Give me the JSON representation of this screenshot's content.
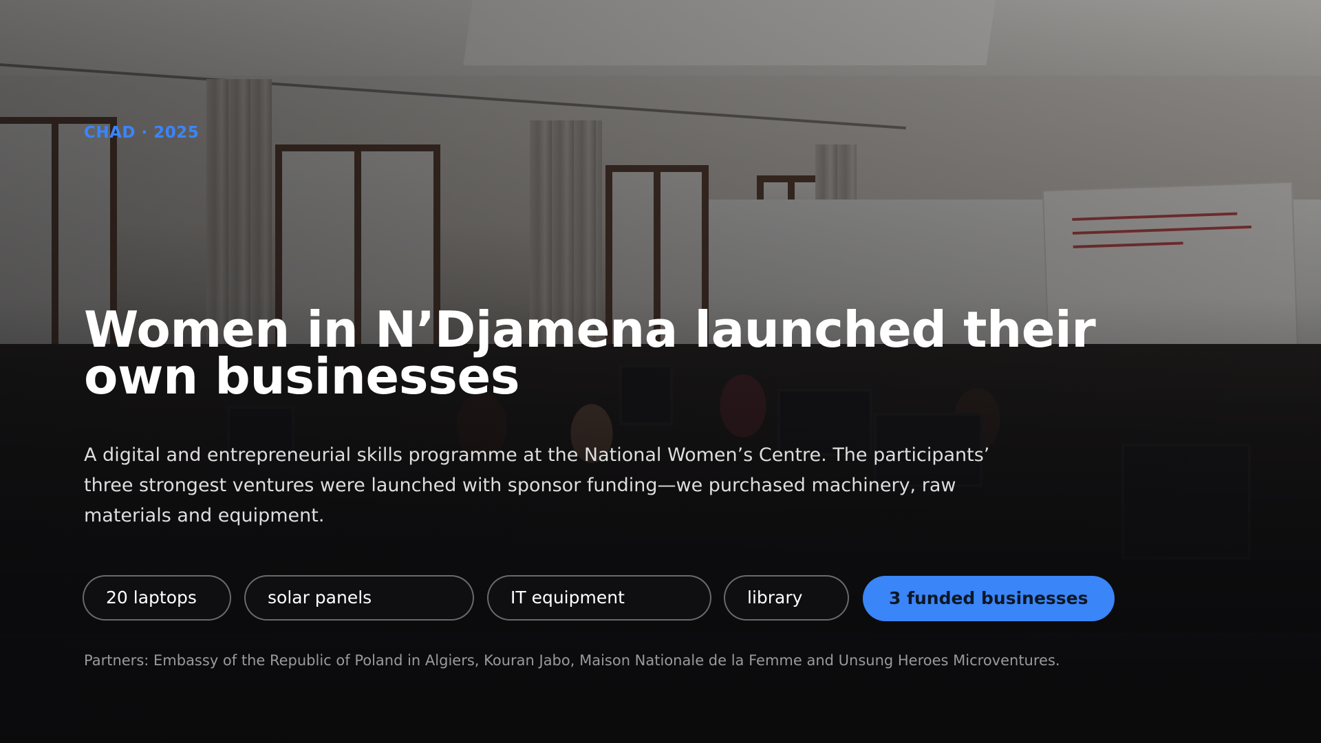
{
  "hero": {
    "eyebrow": "CHAD · 2025",
    "title": "Women in N’Djamena launched their own businesses",
    "description": "A digital and entrepreneurial skills programme at the National Women’s Centre. The participants’ three strongest ventures were launched with sponsor funding—we purchased machinery, raw materials and equipment.",
    "tags": [
      {
        "label": "20 laptops"
      },
      {
        "label": "solar panels"
      },
      {
        "label": "IT equipment"
      },
      {
        "label": "library"
      }
    ],
    "highlight_tag": {
      "label": "3 funded businesses"
    },
    "partners": "Partners: Embassy of the Republic of Poland in Algiers, Kouran Jabo, Maison Nationale de la Femme and Unsung Heroes Microventures."
  },
  "colors": {
    "accent": "#3a85f7",
    "eyebrow": "#3a85ff",
    "background": "#0b0b0c"
  }
}
